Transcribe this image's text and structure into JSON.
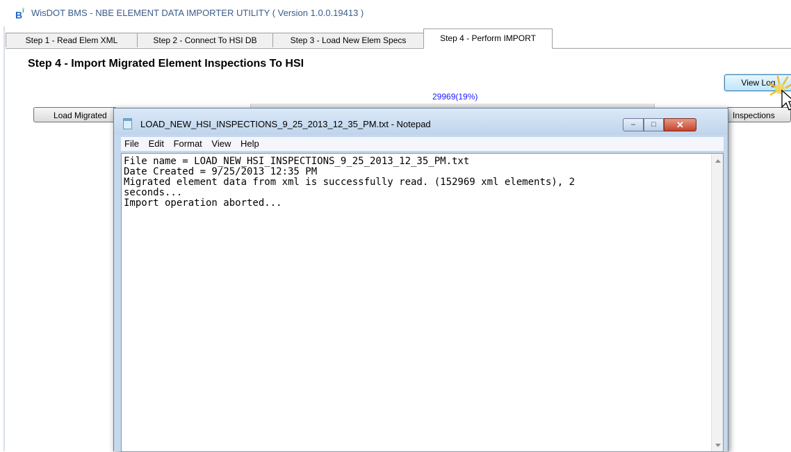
{
  "app": {
    "icon_text": "B",
    "title": "WisDOT BMS - NBE ELEMENT DATA IMPORTER UTILITY ( Version 1.0.0.19413 )"
  },
  "tabs": [
    {
      "label": "Step 1 - Read Elem XML"
    },
    {
      "label": "Step 2 - Connect To HSI DB"
    },
    {
      "label": "Step 3 - Load New Elem Specs"
    },
    {
      "label": "Step 4 - Perform IMPORT",
      "active": true
    }
  ],
  "step": {
    "heading": "Step 4 - Import Migrated Element Inspections To HSI",
    "progress_text": "29969(19%)",
    "progress_fraction": 0.19,
    "buttons": {
      "view_log": "View Log",
      "load_migrated": "Load Migrated",
      "inspections": "Inspections"
    }
  },
  "notepad": {
    "title": "LOAD_NEW_HSI_INSPECTIONS_9_25_2013_12_35_PM.txt - Notepad",
    "menu": [
      "File",
      "Edit",
      "Format",
      "View",
      "Help"
    ],
    "lines": [
      "File name = LOAD_NEW_HSI_INSPECTIONS_9_25_2013_12_35_PM.txt",
      "Date Created = 9/25/2013 12:35 PM",
      "Migrated element data from xml is successfully read. (152969 xml elements), 2",
      "seconds...",
      "Import operation aborted..."
    ]
  },
  "colors": {
    "progress_text": "#1a1aff",
    "title_text": "#3a5c8a",
    "close_button": "#c4452c"
  }
}
